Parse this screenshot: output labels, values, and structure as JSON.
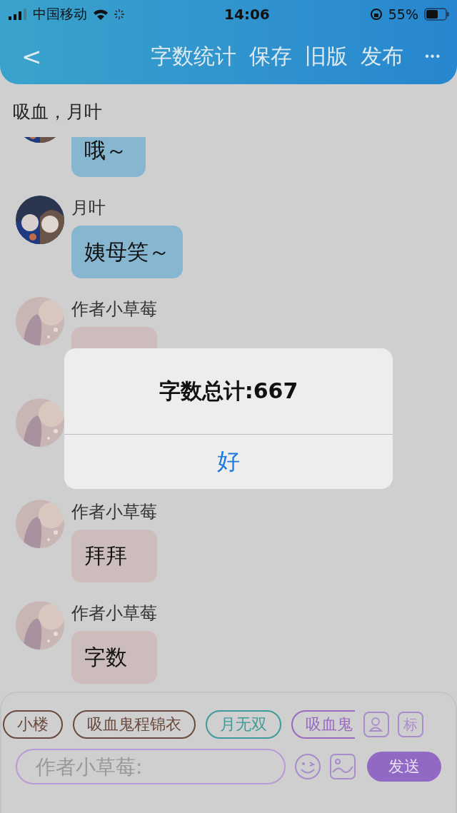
{
  "status_bar": {
    "carrier": "中国移动",
    "time": "14:06",
    "battery": "55%"
  },
  "header": {
    "back": "<",
    "actions": [
      "字数统计",
      "保存",
      "旧版",
      "发布"
    ],
    "more": "•••"
  },
  "subtitle": "吸血，月叶",
  "messages": [
    {
      "kind": "message",
      "text": "哦～",
      "color": "#86b6d0"
    },
    {
      "kind": "message",
      "name": "月叶",
      "text": "姨母笑～",
      "color": "#86b6d0"
    },
    {
      "kind": "message",
      "name": "作者小草莓",
      "color": "#cdbcbc"
    },
    {
      "kind": "avatar_only"
    },
    {
      "kind": "message",
      "name": "作者小草莓",
      "text": "拜拜",
      "color": "#cdbcbc"
    },
    {
      "kind": "message",
      "name": "作者小草莓",
      "text": "字数",
      "color": "#cdbcbc"
    }
  ],
  "dialog": {
    "title": "字数总计:667",
    "button": "好"
  },
  "composer": {
    "chips": [
      {
        "label": "小楼",
        "color": "#6b4a3e"
      },
      {
        "label": "吸血鬼程锦衣",
        "color": "#6b4a3e"
      },
      {
        "label": "月无双",
        "color": "#3f9a9a"
      },
      {
        "label": "吸血鬼",
        "color": "#9a6ac0"
      }
    ],
    "tag_button": "标",
    "placeholder": "作者小草莓:",
    "send": "发送"
  }
}
